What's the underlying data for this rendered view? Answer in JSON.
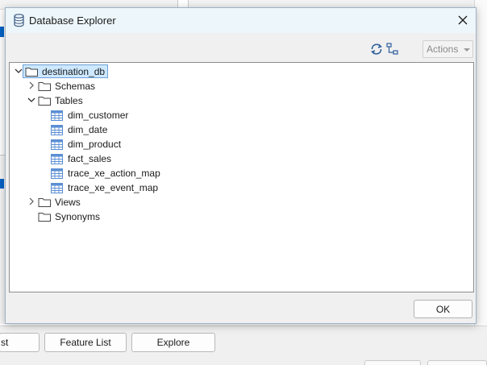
{
  "background": {
    "bottom_buttons": [
      {
        "label": "st"
      },
      {
        "label": "Feature List"
      },
      {
        "label": "Explore"
      }
    ]
  },
  "dialog": {
    "title": "Database Explorer",
    "title_icon": "database-icon",
    "close_icon": "close-icon",
    "toolbar": {
      "refresh_icon": "refresh-icon",
      "hierarchy_icon": "hierarchy-icon",
      "actions_label": "Actions"
    },
    "tree": {
      "root": {
        "label": "destination_db",
        "expanded": true,
        "selected": true
      },
      "nodes": [
        {
          "label": "Schemas",
          "type": "folder",
          "expanded": false
        },
        {
          "label": "Tables",
          "type": "folder",
          "expanded": true
        },
        {
          "label": "dim_customer",
          "type": "table"
        },
        {
          "label": "dim_date",
          "type": "table"
        },
        {
          "label": "dim_product",
          "type": "table"
        },
        {
          "label": "fact_sales",
          "type": "table"
        },
        {
          "label": "trace_xe_action_map",
          "type": "table"
        },
        {
          "label": "trace_xe_event_map",
          "type": "table"
        },
        {
          "label": "Views",
          "type": "folder",
          "expanded": false
        },
        {
          "label": "Synonyms",
          "type": "folder",
          "expanded": false
        }
      ]
    },
    "ok_label": "OK"
  },
  "colors": {
    "accent": "#0063c7",
    "selection_bg": "#cde8ff",
    "selection_border": "#6b9fd6",
    "titlebar_bg": "#edf6fa",
    "table_icon": "#5b8fd4"
  }
}
